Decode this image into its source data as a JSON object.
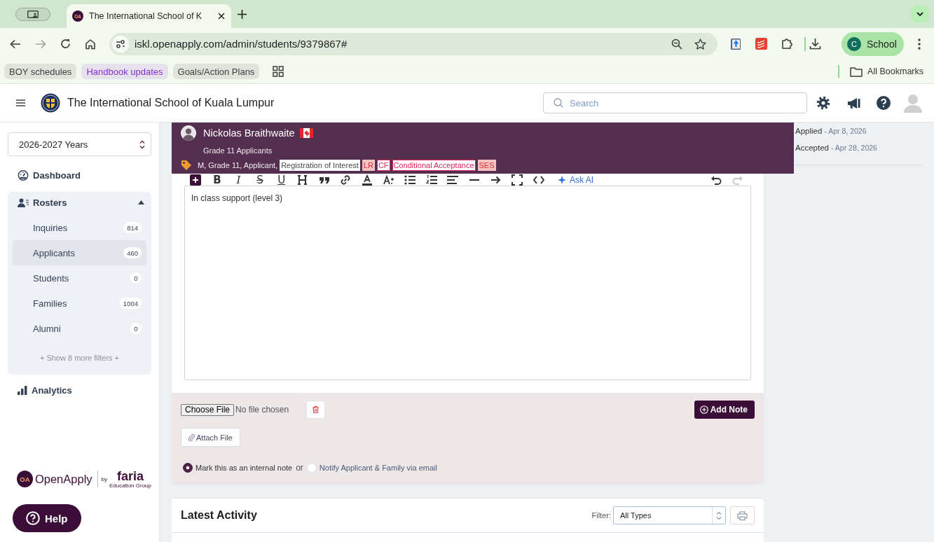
{
  "browser": {
    "favicon": "OA",
    "tab_title": "The International School of K",
    "url": "iskl.openapply.com/admin/students/9379867#",
    "profile": {
      "initial": "C",
      "name": "School"
    },
    "bookmarks": [
      {
        "label": "BOY schedules",
        "color": "#3c4043"
      },
      {
        "label": "Handbook updates",
        "color": "#8430ce"
      },
      {
        "label": "Goals/Action Plans",
        "color": "#3c4043"
      }
    ],
    "all_bookmarks": "All Bookmarks"
  },
  "header": {
    "school": "The International School of Kuala Lumpur",
    "search_placeholder": "Search"
  },
  "sidebar": {
    "year": "2026-2027 Years",
    "dashboard": "Dashboard",
    "rosters": {
      "label": "Rosters",
      "expanded": true,
      "items": [
        {
          "label": "Inquiries",
          "count": "814",
          "selected": false
        },
        {
          "label": "Applicants",
          "count": "460",
          "selected": true
        },
        {
          "label": "Students",
          "count": "0",
          "selected": false
        },
        {
          "label": "Families",
          "count": "1004",
          "selected": false
        },
        {
          "label": "Alumni",
          "count": "0",
          "selected": false
        }
      ],
      "more": "+ Show 8 more filters +"
    },
    "analytics": "Analytics"
  },
  "brand": {
    "mark": "OA",
    "name": "OpenApply",
    "by": "by",
    "partner": "faria",
    "partner_sub": "Education Group"
  },
  "help_button": "Help",
  "student": {
    "name": "Nickolas Braithwaite",
    "group": "Grade 11 Applicants",
    "summary": "M, Grade 11, Applicant,",
    "tags": [
      {
        "label": "Registration of Interest",
        "kind": "plain",
        "color": "#4a4a4a"
      },
      {
        "label": "LR",
        "kind": "soft",
        "color": "#d0312d"
      },
      {
        "label": "CF",
        "kind": "outline",
        "color": "#e0245e"
      },
      {
        "label": "Conditional Acceptance",
        "kind": "outline",
        "color": "#e0245e"
      },
      {
        "label": "SES",
        "kind": "soft",
        "color": "#d0312d"
      }
    ]
  },
  "editor": {
    "format_buttons": [
      "B",
      "I",
      "S",
      "U"
    ],
    "ai_label": "Ask AI",
    "content": "In class support (level 3)",
    "file_button": "Choose File",
    "file_status": "No file chosen",
    "attach": "Attach File",
    "submit": "Add Note",
    "visibility": [
      {
        "label": "Mark this as an internal note",
        "selected": true
      },
      {
        "label": "Notify Applicant & Family via email",
        "selected": false
      }
    ],
    "or": "or"
  },
  "milestones": [
    {
      "label": "Applied",
      "date": "- Apr 8, 2026"
    },
    {
      "label": "Accepted",
      "date": "- Apr 28, 2026"
    }
  ],
  "activity": {
    "title": "Latest Activity",
    "filter_label": "Filter:",
    "filter_value": "All Types"
  }
}
